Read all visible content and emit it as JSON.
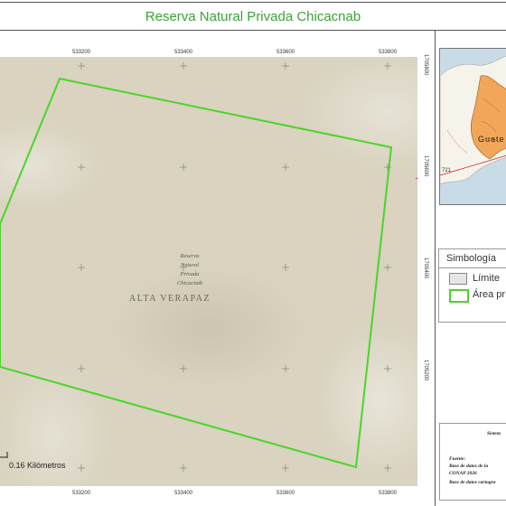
{
  "title": "Reserva Natural Privada Chicacnab",
  "map": {
    "region_label": "ALTA VERAPAZ",
    "area_label": [
      "Reserva",
      "Natural",
      "Privada",
      "Chicacnab"
    ],
    "x_ticks": [
      "533200",
      "533400",
      "533600",
      "533800"
    ],
    "y_ticks": [
      "1705800",
      "1705600",
      "1705400",
      "1705200"
    ],
    "scale_label": "0.16 Kilómetros",
    "boundary_color": "#4cd42a"
  },
  "inset": {
    "country_label": "Guate",
    "road_label": "721",
    "highlight_color": "#f2a65a",
    "pointer_color": "#cc2222"
  },
  "legend": {
    "title": "Simbología",
    "items": [
      {
        "label": "Límite",
        "color": "#e6e6e6"
      },
      {
        "label": "Área pr",
        "color": "#4cd42a"
      }
    ]
  },
  "source": {
    "header": "Sistem",
    "label": "Fuente:",
    "lines": [
      "Base de datos de la",
      "CONAP 2026",
      "Base de datos cartogra"
    ]
  }
}
